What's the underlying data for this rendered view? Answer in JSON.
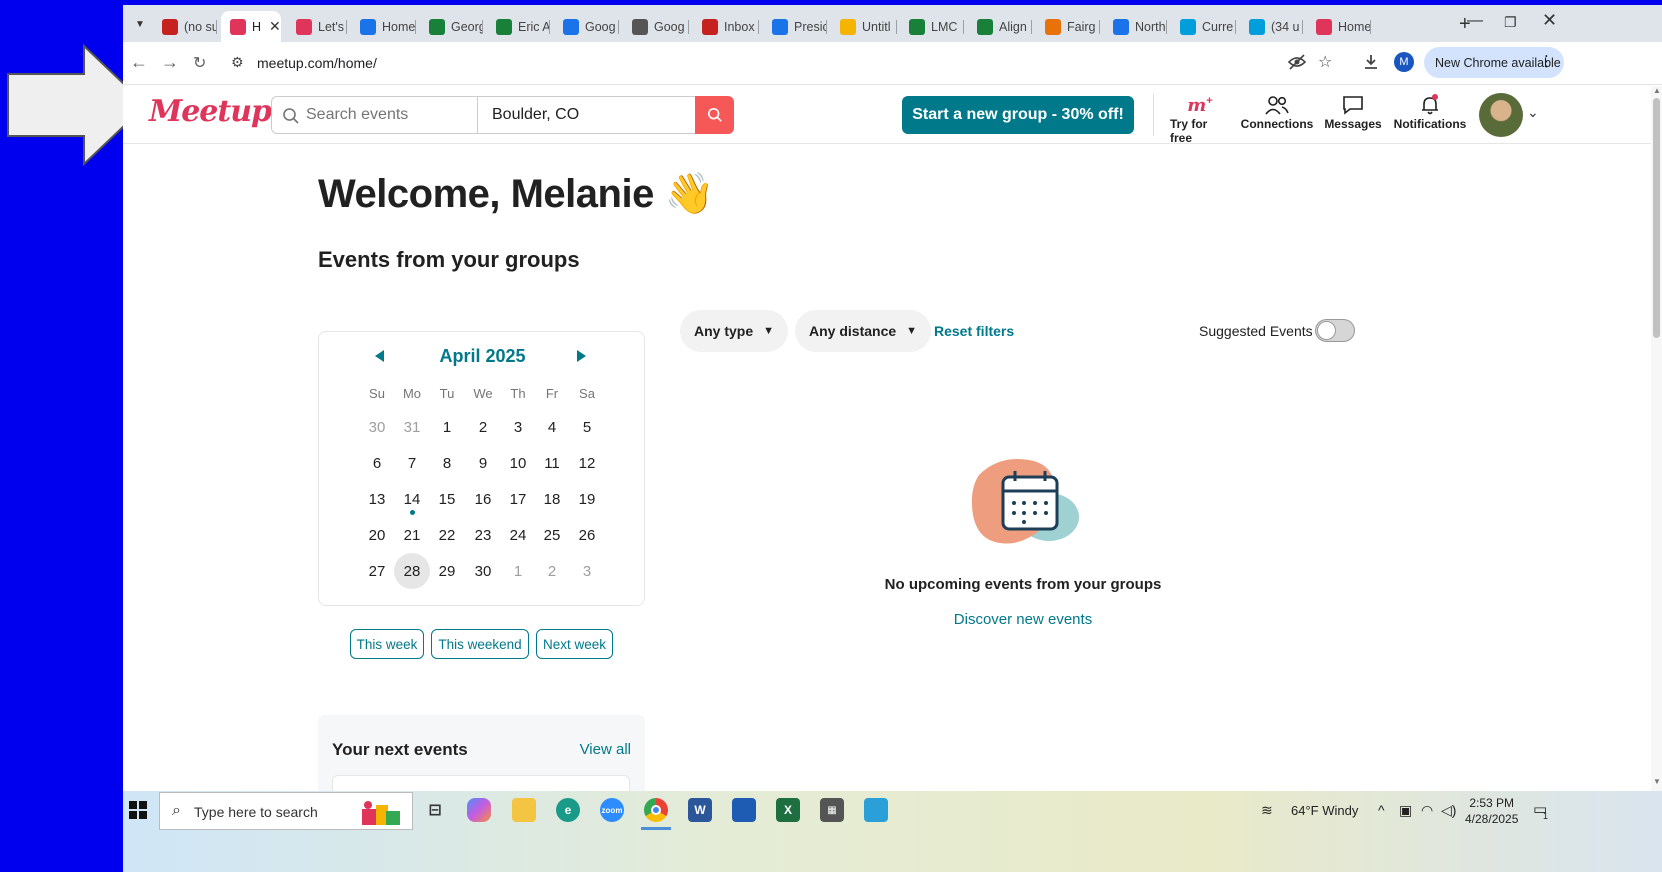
{
  "browser": {
    "tabs": [
      {
        "label": "(no su",
        "icon": "gmail-icon",
        "color": "#c5221f"
      },
      {
        "label": "H",
        "icon": "meetup-icon",
        "color": "#e0355b",
        "active": true
      },
      {
        "label": "Let's j",
        "icon": "meetup-icon",
        "color": "#e0355b"
      },
      {
        "label": "Home",
        "icon": "drive-icon",
        "color": "#1a73e8"
      },
      {
        "label": "Georg",
        "icon": "sheets-icon",
        "color": "#188038"
      },
      {
        "label": "Eric A",
        "icon": "sheets-icon",
        "color": "#188038"
      },
      {
        "label": "Goog",
        "icon": "calendar-icon",
        "color": "#1a73e8"
      },
      {
        "label": "Goog",
        "icon": "chrome-icon",
        "color": "#555555"
      },
      {
        "label": "Inbox",
        "icon": "gmail-icon",
        "color": "#c5221f"
      },
      {
        "label": "Presic",
        "icon": "docs-icon",
        "color": "#1a73e8"
      },
      {
        "label": "Untitl",
        "icon": "slides-icon",
        "color": "#f4b400"
      },
      {
        "label": "LMC",
        "icon": "sheets-icon",
        "color": "#188038"
      },
      {
        "label": "Align",
        "icon": "align-icon",
        "color": "#188038"
      },
      {
        "label": "Fairg",
        "icon": "fairgrounds-icon",
        "color": "#e8710a"
      },
      {
        "label": "North",
        "icon": "maps-icon",
        "color": "#1a73e8"
      },
      {
        "label": "Curre",
        "icon": "att-icon",
        "color": "#009fdb"
      },
      {
        "label": "(34 u",
        "icon": "att-icon",
        "color": "#009fdb"
      },
      {
        "label": "Home",
        "icon": "meetup-icon",
        "color": "#e0355b"
      }
    ],
    "url": "meetup.com/home/",
    "profile_initial": "M",
    "update_label": "New Chrome available"
  },
  "header": {
    "logo": "Meetup",
    "search_placeholder": "Search events",
    "location": "Boulder, CO",
    "start_group_label": "Start a new group - 30% off!",
    "nav": [
      {
        "label": "Try for free",
        "icon": "meetup-plus-icon"
      },
      {
        "label": "Connections",
        "icon": "connections-icon"
      },
      {
        "label": "Messages",
        "icon": "messages-icon"
      },
      {
        "label": "Notifications",
        "icon": "bell-icon"
      }
    ]
  },
  "main": {
    "welcome": "Welcome, Melanie 👋",
    "section_title": "Events from your groups",
    "calendar": {
      "month": "April 2025",
      "weekdays": [
        "Su",
        "Mo",
        "Tu",
        "We",
        "Th",
        "Fr",
        "Sa"
      ],
      "weeks": [
        [
          "30",
          "31",
          "1",
          "2",
          "3",
          "4",
          "5"
        ],
        [
          "6",
          "7",
          "8",
          "9",
          "10",
          "11",
          "12"
        ],
        [
          "13",
          "14",
          "15",
          "16",
          "17",
          "18",
          "19"
        ],
        [
          "20",
          "21",
          "22",
          "23",
          "24",
          "25",
          "26"
        ],
        [
          "27",
          "28",
          "29",
          "30",
          "1",
          "2",
          "3"
        ]
      ],
      "selected": "28",
      "event_day": "14"
    },
    "quick_filters": [
      "This week",
      "This weekend",
      "Next week"
    ],
    "filters": {
      "type": "Any type",
      "distance": "Any distance",
      "reset": "Reset filters"
    },
    "suggested_label": "Suggested Events",
    "suggested_on": false,
    "empty_message": "No upcoming events from your groups",
    "discover_link": "Discover new events",
    "next_events": {
      "title": "Your next events",
      "view_all": "View all"
    }
  },
  "taskbar": {
    "search_placeholder": "Type here to search",
    "weather": "64°F  Windy",
    "time": "2:53 PM",
    "date": "4/28/2025",
    "notification_count": "1"
  },
  "colors": {
    "teal": "#00798a",
    "meetup_red": "#e0355b",
    "search_red": "#f65858"
  }
}
